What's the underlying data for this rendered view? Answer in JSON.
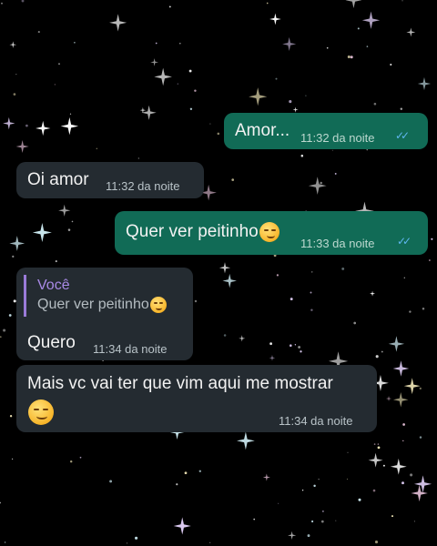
{
  "chat": {
    "messages": [
      {
        "direction": "sent",
        "text": "Amor...",
        "time": "11:32 da noite",
        "status": "read"
      },
      {
        "direction": "received",
        "text": "Oi amor",
        "time": "11:32 da noite"
      },
      {
        "direction": "sent",
        "text": "Quer ver peitinho",
        "emoji": "smirking-face",
        "time": "11:33 da noite",
        "status": "read"
      },
      {
        "direction": "received",
        "text": "Quero",
        "time": "11:34 da noite",
        "quote": {
          "author": "Você",
          "text": "Quer ver peitinho",
          "emoji": "smirking-face"
        }
      },
      {
        "direction": "received",
        "text": "Mais vc vai ter que vim aqui me mostrar",
        "emoji": "smirking-face",
        "time": "11:34 da noite"
      }
    ]
  },
  "colors": {
    "background": "#000000",
    "sent_bubble": "#116b56",
    "received_bubble": "#242b31",
    "read_ticks": "#5fb6ef",
    "quote_accent": "#9a7bd8"
  },
  "icons": {
    "read_receipt": "double-check-icon",
    "emoji": "smirking-face-emoji"
  }
}
